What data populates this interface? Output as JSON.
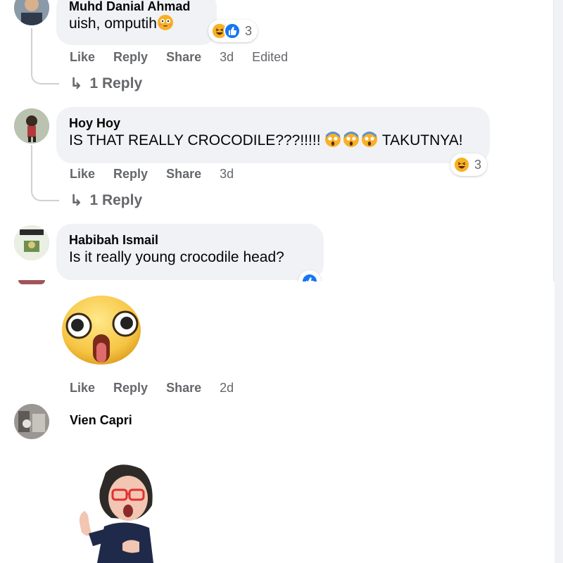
{
  "comments": [
    {
      "author": "Muhd Danial Ahmad",
      "text": "uish, omputih",
      "actions": {
        "like": "Like",
        "reply": "Reply",
        "share": "Share",
        "time": "3d",
        "edited": "Edited"
      },
      "reactions": {
        "count": "3",
        "icons": [
          "laughing-face",
          "thumbs-up"
        ]
      },
      "replies": "1 Reply"
    },
    {
      "author": "Hoy Hoy",
      "text": "IS THAT REALLY CROCODILE???!!!!! ",
      "text_suffix": " TAKUTNYA!",
      "actions": {
        "like": "Like",
        "reply": "Reply",
        "share": "Share",
        "time": "3d"
      },
      "reactions": {
        "count": "3",
        "icons": [
          "laughing-face"
        ]
      },
      "replies": "1 Reply"
    },
    {
      "author": "Habibah Ismail",
      "text": "Is it really young crocodile head?",
      "actions": {
        "like": "Like",
        "reply": "Reply",
        "share": "Share",
        "time": "2d"
      },
      "reactions": {
        "icons": [
          "thumbs-up"
        ]
      },
      "sticker": "shocked-face-sticker"
    },
    {
      "author": "Vien Capri",
      "sticker": "avatar-sticker"
    }
  ],
  "colors": {
    "bubble": "#f0f2f5",
    "muted": "#65676b",
    "like_blue": "#1877f2",
    "haha_yellow": "#f7b125"
  }
}
